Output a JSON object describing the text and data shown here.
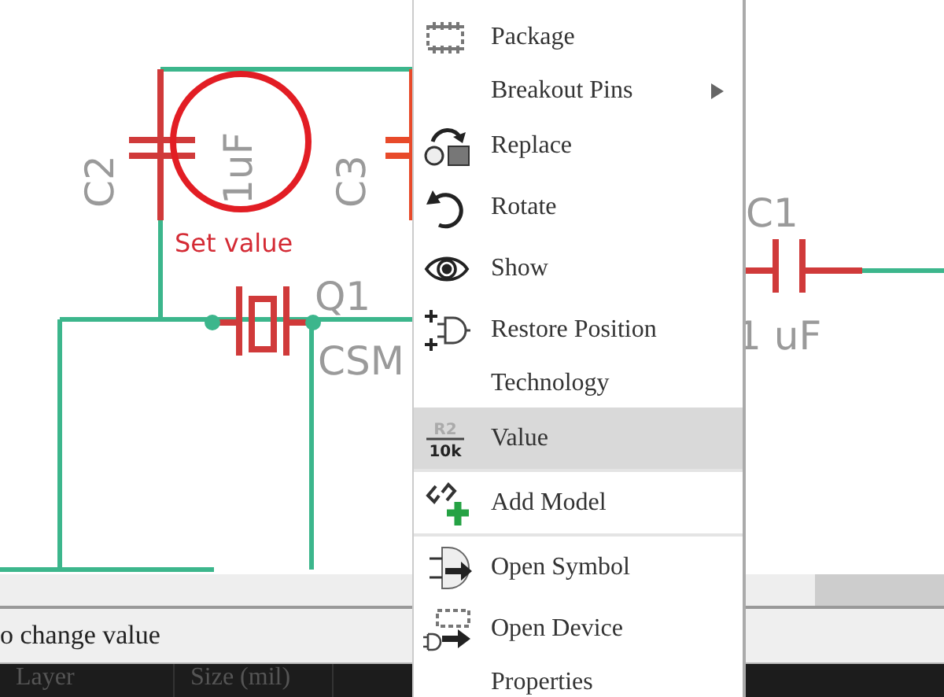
{
  "schematic": {
    "parts": [
      {
        "name": "C2",
        "value": "1uF"
      },
      {
        "name": "C3"
      },
      {
        "name": "Q1",
        "value": "CSM"
      },
      {
        "name": "C1",
        "value": "1 uF"
      }
    ],
    "annotation": "Set value"
  },
  "context_menu": {
    "items": [
      {
        "label": "Package",
        "kind": "package",
        "selected": false,
        "separator_before": false,
        "has_submenu": false
      },
      {
        "label": "Breakout Pins",
        "selected": false,
        "separator_before": false,
        "has_submenu": true
      },
      {
        "label": "Replace",
        "kind": "replace",
        "selected": false,
        "separator_before": false,
        "has_submenu": false
      },
      {
        "label": "Rotate",
        "kind": "rotate",
        "selected": false,
        "separator_before": false,
        "has_submenu": false
      },
      {
        "label": "Show",
        "kind": "show",
        "selected": false,
        "separator_before": false,
        "has_submenu": false
      },
      {
        "label": "Restore Position",
        "kind": "restore",
        "selected": false,
        "separator_before": false,
        "has_submenu": false
      },
      {
        "label": "Technology",
        "selected": false,
        "separator_before": false,
        "has_submenu": false
      },
      {
        "label": "Value",
        "kind": "value",
        "icon_text": [
          "R2",
          "10k"
        ],
        "selected": true,
        "separator_before": false,
        "has_submenu": false
      },
      {
        "label": "Add Model",
        "kind": "model",
        "selected": false,
        "separator_before": true,
        "has_submenu": false
      },
      {
        "label": "Open Symbol",
        "kind": "symbol",
        "selected": false,
        "separator_before": true,
        "has_submenu": false
      },
      {
        "label": "Open Device",
        "kind": "device",
        "selected": false,
        "separator_before": false,
        "has_submenu": false
      },
      {
        "label": "Properties",
        "selected": false,
        "separator_before": false,
        "has_submenu": false
      }
    ]
  },
  "status_bar": {
    "text": "o change value"
  },
  "table": {
    "columns": [
      "Layer",
      "Size (mil)"
    ]
  }
}
